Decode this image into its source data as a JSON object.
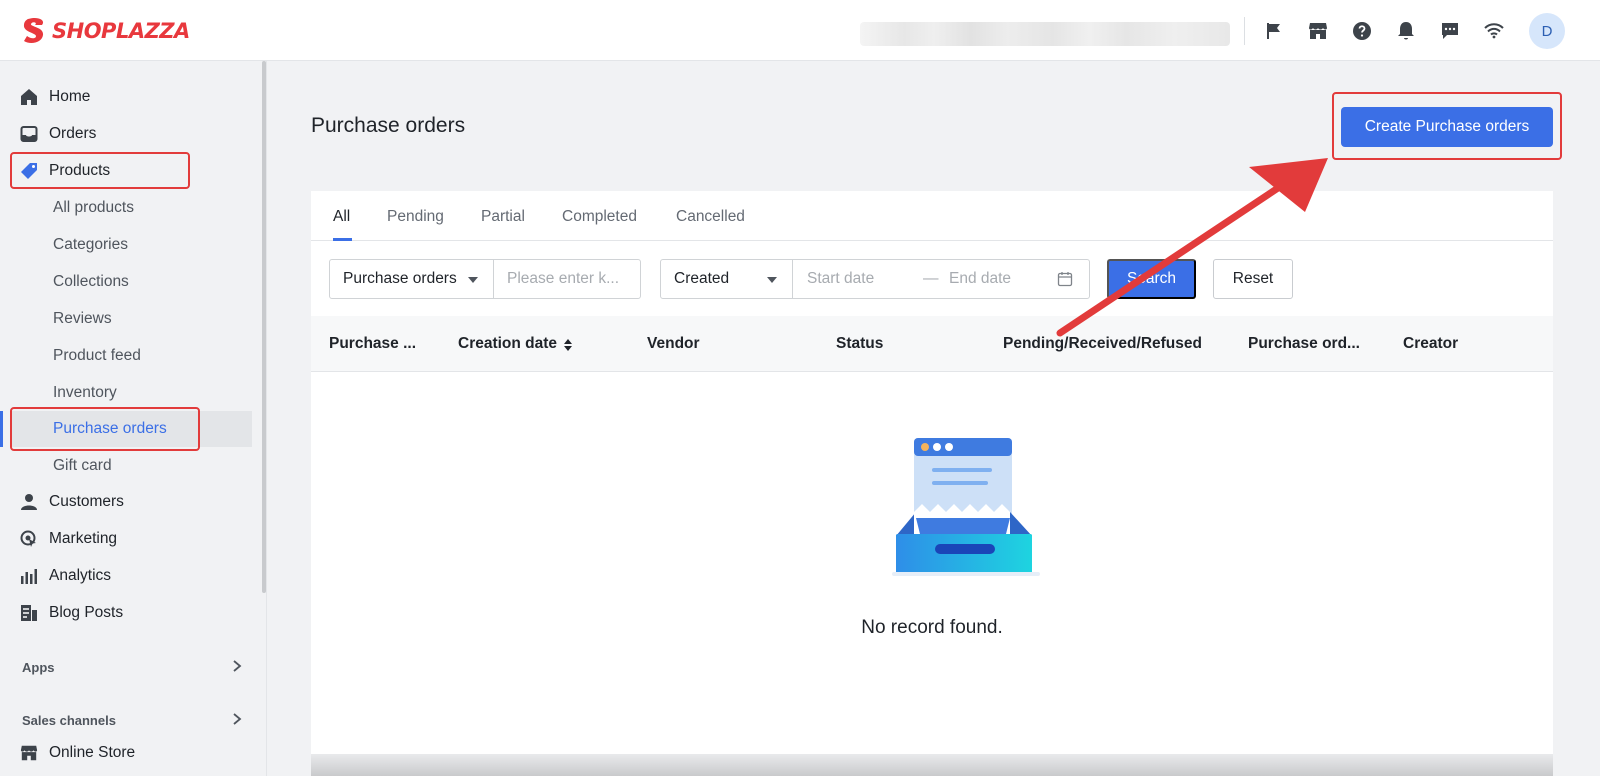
{
  "brand": {
    "name": "SHOPLAZZA",
    "accent": "#e8383d"
  },
  "header": {
    "icons": [
      "flag-icon",
      "store-icon",
      "help-icon",
      "bell-icon",
      "chat-icon",
      "wifi-icon"
    ],
    "avatar_initial": "D"
  },
  "sidebar": {
    "items": [
      {
        "label": "Home",
        "icon": "home-icon"
      },
      {
        "label": "Orders",
        "icon": "inbox-icon"
      },
      {
        "label": "Products",
        "icon": "tag-icon"
      }
    ],
    "product_sub": [
      "All products",
      "Categories",
      "Collections",
      "Reviews",
      "Product feed",
      "Inventory",
      "Purchase orders",
      "Gift card"
    ],
    "items2": [
      {
        "label": "Customers",
        "icon": "person-icon"
      },
      {
        "label": "Marketing",
        "icon": "marketing-icon"
      },
      {
        "label": "Analytics",
        "icon": "analytics-icon"
      },
      {
        "label": "Blog Posts",
        "icon": "blog-icon"
      }
    ],
    "apps_label": "Apps",
    "sales_channels_label": "Sales channels",
    "online_store": {
      "label": "Online Store",
      "icon": "store-icon"
    }
  },
  "main": {
    "title": "Purchase orders",
    "create_button": "Create Purchase orders",
    "tabs": [
      "All",
      "Pending",
      "Partial",
      "Completed",
      "Cancelled"
    ],
    "filters": {
      "field_select": "Purchase orders",
      "keyword_placeholder": "Please enter k...",
      "date_type": "Created",
      "start_placeholder": "Start date",
      "separator": "—",
      "end_placeholder": "End date",
      "search": "Search",
      "reset": "Reset"
    },
    "columns": [
      "Purchase ...",
      "Creation date",
      "Vendor",
      "Status",
      "Pending/Received/Refused",
      "Purchase ord...",
      "Creator"
    ],
    "empty_text": "No record found."
  },
  "colors": {
    "primary": "#3b6fe6",
    "highlight": "#e23b3b"
  }
}
